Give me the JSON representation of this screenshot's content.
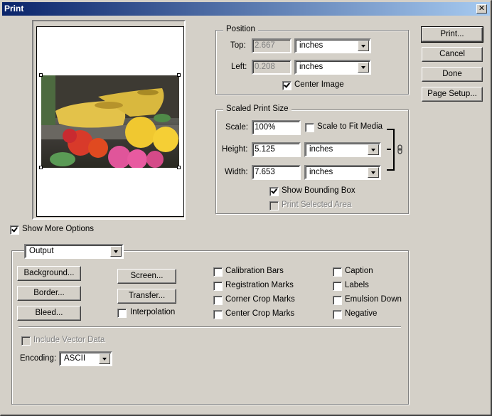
{
  "window": {
    "title": "Print",
    "close_label": "✕"
  },
  "preview": {
    "image_description": "Yellow wooden clogs with red, yellow and pink flowers"
  },
  "position": {
    "legend": "Position",
    "top_label": "Top:",
    "top_value": "2.667",
    "top_unit": "inches",
    "left_label": "Left:",
    "left_value": "0.208",
    "left_unit": "inches",
    "center_image_label": "Center Image",
    "center_image_checked": true
  },
  "scaled": {
    "legend": "Scaled Print Size",
    "scale_label": "Scale:",
    "scale_value": "100%",
    "scale_to_fit_label": "Scale to Fit Media",
    "scale_to_fit_checked": false,
    "height_label": "Height:",
    "height_value": "5.125",
    "height_unit": "inches",
    "width_label": "Width:",
    "width_value": "7.653",
    "width_unit": "inches",
    "show_bounding_box_label": "Show Bounding Box",
    "show_bounding_box_checked": true,
    "print_selected_area_label": "Print Selected Area",
    "print_selected_area_checked": false
  },
  "buttons": {
    "print": "Print...",
    "cancel": "Cancel",
    "done": "Done",
    "page_setup": "Page Setup..."
  },
  "show_more_options": {
    "label": "Show More Options",
    "checked": true
  },
  "output": {
    "dropdown_value": "Output",
    "background": "Background...",
    "border": "Border...",
    "bleed": "Bleed...",
    "screen": "Screen...",
    "transfer": "Transfer...",
    "interpolation": "Interpolation",
    "checkboxes_col1": [
      "Calibration Bars",
      "Registration Marks",
      "Corner Crop Marks",
      "Center Crop Marks"
    ],
    "checkboxes_col2": [
      "Caption",
      "Labels",
      "Emulsion Down",
      "Negative"
    ],
    "include_vector_data": "Include Vector Data",
    "encoding_label": "Encoding:",
    "encoding_value": "ASCII"
  }
}
